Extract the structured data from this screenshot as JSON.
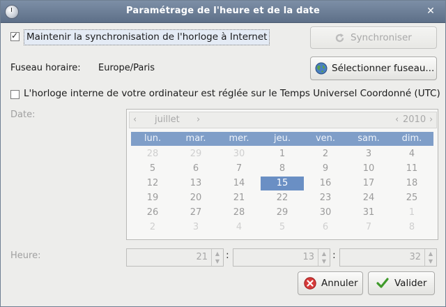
{
  "window": {
    "title": "Paramétrage de l'heure et de la date"
  },
  "sync": {
    "checkbox_label": "Maintenir la synchronisation de l'horloge à Internet",
    "checked": true,
    "button_label": "Synchroniser"
  },
  "timezone": {
    "label": "Fuseau horaire:",
    "value": "Europe/Paris",
    "button_label": "Sélectionner fuseau..."
  },
  "utc": {
    "checkbox_label": "L'horloge interne de votre ordinateur est réglée sur le Temps Universel Coordonné (UTC)",
    "checked": false
  },
  "date": {
    "label": "Date:",
    "month": "juillet",
    "year": "2010",
    "weekdays": [
      "lun.",
      "mar.",
      "mer.",
      "jeu.",
      "ven.",
      "sam.",
      "dim."
    ],
    "weeks": [
      [
        "28",
        "29",
        "30",
        "1",
        "2",
        "3",
        "4"
      ],
      [
        "5",
        "6",
        "7",
        "8",
        "9",
        "10",
        "11"
      ],
      [
        "12",
        "13",
        "14",
        "15",
        "16",
        "17",
        "18"
      ],
      [
        "19",
        "20",
        "21",
        "22",
        "23",
        "24",
        "25"
      ],
      [
        "26",
        "27",
        "28",
        "29",
        "30",
        "31",
        "1"
      ],
      [
        "2",
        "3",
        "4",
        "5",
        "6",
        "7",
        "8"
      ]
    ],
    "selected_day": "15"
  },
  "time": {
    "label": "Heure:",
    "hours": "21",
    "minutes": "13",
    "seconds": "32",
    "separator": ":"
  },
  "buttons": {
    "cancel_label": "Annuler",
    "ok_label": "Valider"
  },
  "colors": {
    "titlebar": "#6a7c95",
    "selection": "#6a8fc4",
    "weekday_header": "#7f9ec8"
  }
}
